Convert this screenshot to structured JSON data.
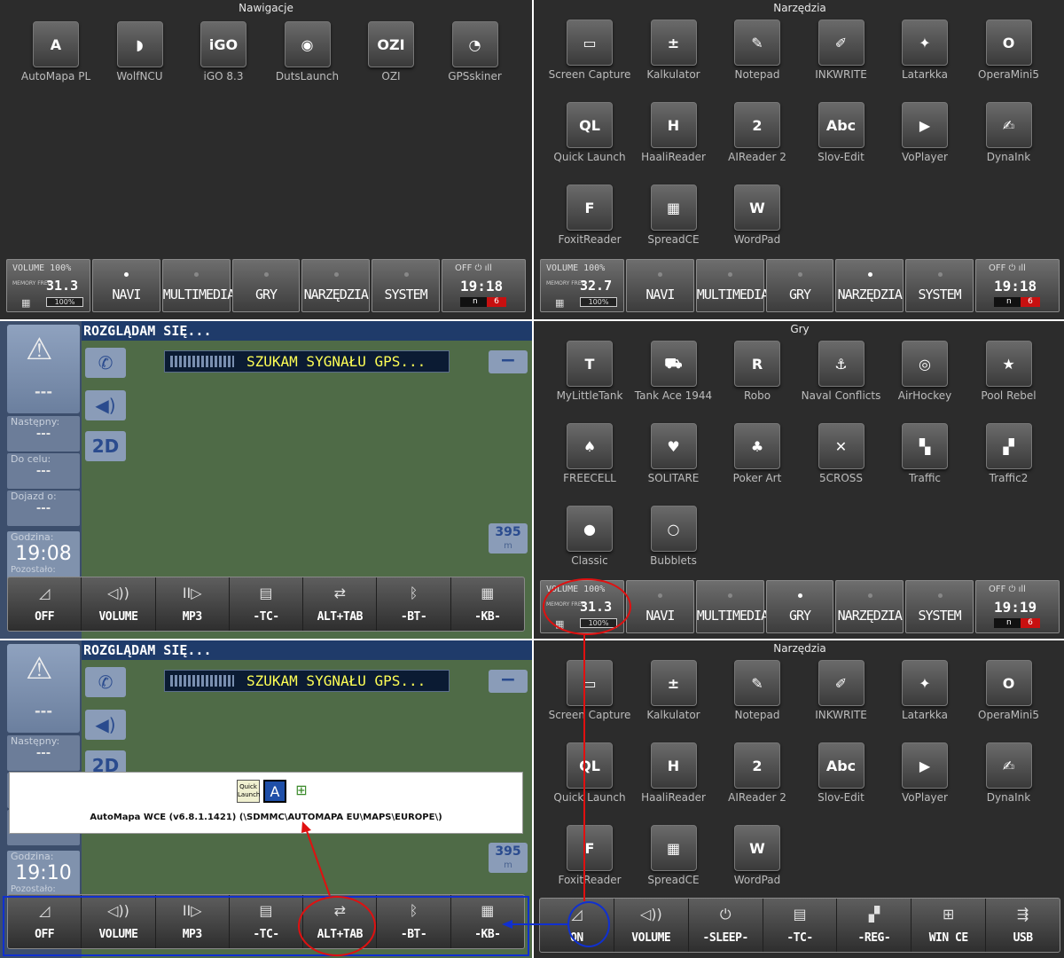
{
  "panels": {
    "nav_apps": {
      "title": "Nawigacje",
      "apps": [
        {
          "label": "AutoMapa PL",
          "glyph": "A"
        },
        {
          "label": "WolfNCU",
          "glyph": "◗"
        },
        {
          "label": "iGO 8.3",
          "glyph": "iGO"
        },
        {
          "label": "DutsLaunch",
          "glyph": "◉"
        },
        {
          "label": "OZI",
          "glyph": "OZI"
        },
        {
          "label": "GPSskiner",
          "glyph": "◔"
        }
      ]
    },
    "tools_1": {
      "title": "Narzędzia",
      "apps": [
        {
          "label": "Screen Capture",
          "glyph": "▭"
        },
        {
          "label": "Kalkulator",
          "glyph": "±"
        },
        {
          "label": "Notepad",
          "glyph": "✎"
        },
        {
          "label": "INKWRITE",
          "glyph": "✐"
        },
        {
          "label": "Latarkka",
          "glyph": "✦"
        },
        {
          "label": "OperaMini5",
          "glyph": "O"
        },
        {
          "label": "Quick Launch",
          "glyph": "QL"
        },
        {
          "label": "HaaliReader",
          "glyph": "H"
        },
        {
          "label": "AIReader 2",
          "glyph": "2"
        },
        {
          "label": "Slov-Edit",
          "glyph": "Abc"
        },
        {
          "label": "VoPlayer",
          "glyph": "▶"
        },
        {
          "label": "DynaInk",
          "glyph": "✍"
        },
        {
          "label": "FoxitReader",
          "glyph": "F"
        },
        {
          "label": "SpreadCE",
          "glyph": "▦"
        },
        {
          "label": "WordPad",
          "glyph": "W"
        }
      ]
    },
    "games": {
      "title": "Gry",
      "apps": [
        {
          "label": "MyLittleTank",
          "glyph": "T"
        },
        {
          "label": "Tank Ace 1944",
          "glyph": "⛟"
        },
        {
          "label": "Robo",
          "glyph": "R"
        },
        {
          "label": "Naval Conflicts",
          "glyph": "⚓"
        },
        {
          "label": "AirHockey",
          "glyph": "◎"
        },
        {
          "label": "Pool Rebel",
          "glyph": "★"
        },
        {
          "label": "FREECELL",
          "glyph": "♠"
        },
        {
          "label": "SOLITARE",
          "glyph": "♥"
        },
        {
          "label": "Poker Art",
          "glyph": "♣"
        },
        {
          "label": "5CROSS",
          "glyph": "✕"
        },
        {
          "label": "Traffic",
          "glyph": "▚"
        },
        {
          "label": "Traffic2",
          "glyph": "▞"
        },
        {
          "label": "Classic",
          "glyph": "●"
        },
        {
          "label": "Bubblets",
          "glyph": "○"
        }
      ]
    },
    "tools_2": {
      "title": "Narzędzia",
      "apps": [
        {
          "label": "Screen Capture",
          "glyph": "▭"
        },
        {
          "label": "Kalkulator",
          "glyph": "±"
        },
        {
          "label": "Notepad",
          "glyph": "✎"
        },
        {
          "label": "INKWRITE",
          "glyph": "✐"
        },
        {
          "label": "Latarkka",
          "glyph": "✦"
        },
        {
          "label": "OperaMini5",
          "glyph": "O"
        },
        {
          "label": "Quick Launch",
          "glyph": "QL"
        },
        {
          "label": "HaaliReader",
          "glyph": "H"
        },
        {
          "label": "AIReader 2",
          "glyph": "2"
        },
        {
          "label": "Slov-Edit",
          "glyph": "Abc"
        },
        {
          "label": "VoPlayer",
          "glyph": "▶"
        },
        {
          "label": "DynaInk",
          "glyph": "✍"
        },
        {
          "label": "FoxitReader",
          "glyph": "F"
        },
        {
          "label": "SpreadCE",
          "glyph": "▦"
        },
        {
          "label": "WordPad",
          "glyph": "W"
        }
      ]
    }
  },
  "status": {
    "volume": "VOLUME 100%",
    "memory_label": "MEMORY FREE",
    "battery": "100%",
    "off": "OFF",
    "indicator_n": "n",
    "indicator_six": "6",
    "mem_a": "31.3",
    "mem_b": "32.7",
    "time_a": "19:18",
    "time_b": "19:19"
  },
  "tabs": [
    "NAVI",
    "MULTIMEDIA",
    "GRY",
    "NARZĘDZIA",
    "SYSTEM"
  ],
  "tab_active": {
    "nav_apps": 0,
    "tools_1": 3,
    "games": 2
  },
  "navigation": {
    "header": "ROZGLĄDAM SIĘ...",
    "gps": "SZUKAM SYGNAŁU GPS...",
    "dashes": "---",
    "next_label": "Następny:",
    "target_label": "Do celu:",
    "arrival_label": "Dojazd o:",
    "clock_label": "Godzina:",
    "clock_a": "19:08",
    "clock_b": "19:10",
    "remaining_label": "Pozostało:",
    "view_2d": "2D",
    "zoom": "−",
    "scale": "395",
    "scale_unit": "m",
    "popup_caption": "AutoMapa WCE (v6.8.1.1421) (\\SDMMC\\AUTOMAPA EU\\MAPS\\EUROPE\\)",
    "popup_ql": "Quick Launch"
  },
  "quickbar": [
    {
      "label": "OFF",
      "icon": "◿"
    },
    {
      "label": "VOLUME",
      "icon": "◁))"
    },
    {
      "label": "MP3",
      "icon": "II▷"
    },
    {
      "label": "-TC-",
      "icon": "▤"
    },
    {
      "label": "ALT+TAB",
      "icon": "⇄"
    },
    {
      "label": "-BT-",
      "icon": "ᛒ"
    },
    {
      "label": "-KB-",
      "icon": "▦"
    }
  ],
  "systembar": [
    {
      "label": "ON",
      "icon": "◿"
    },
    {
      "label": "VOLUME",
      "icon": "◁))"
    },
    {
      "label": "-SLEEP-",
      "icon": "⏻"
    },
    {
      "label": "-TC-",
      "icon": "▤"
    },
    {
      "label": "-REG-",
      "icon": "▞"
    },
    {
      "label": "WIN CE",
      "icon": "⊞"
    },
    {
      "label": "USB",
      "icon": "⇶"
    }
  ],
  "colors": {
    "launcher_bg": "#2c2c2c",
    "map_bg": "#4f6b47",
    "header_bg": "#1f3b6a",
    "gps_text": "#ffff55",
    "annotation_red": "#e01010",
    "annotation_blue": "#1030d0"
  }
}
